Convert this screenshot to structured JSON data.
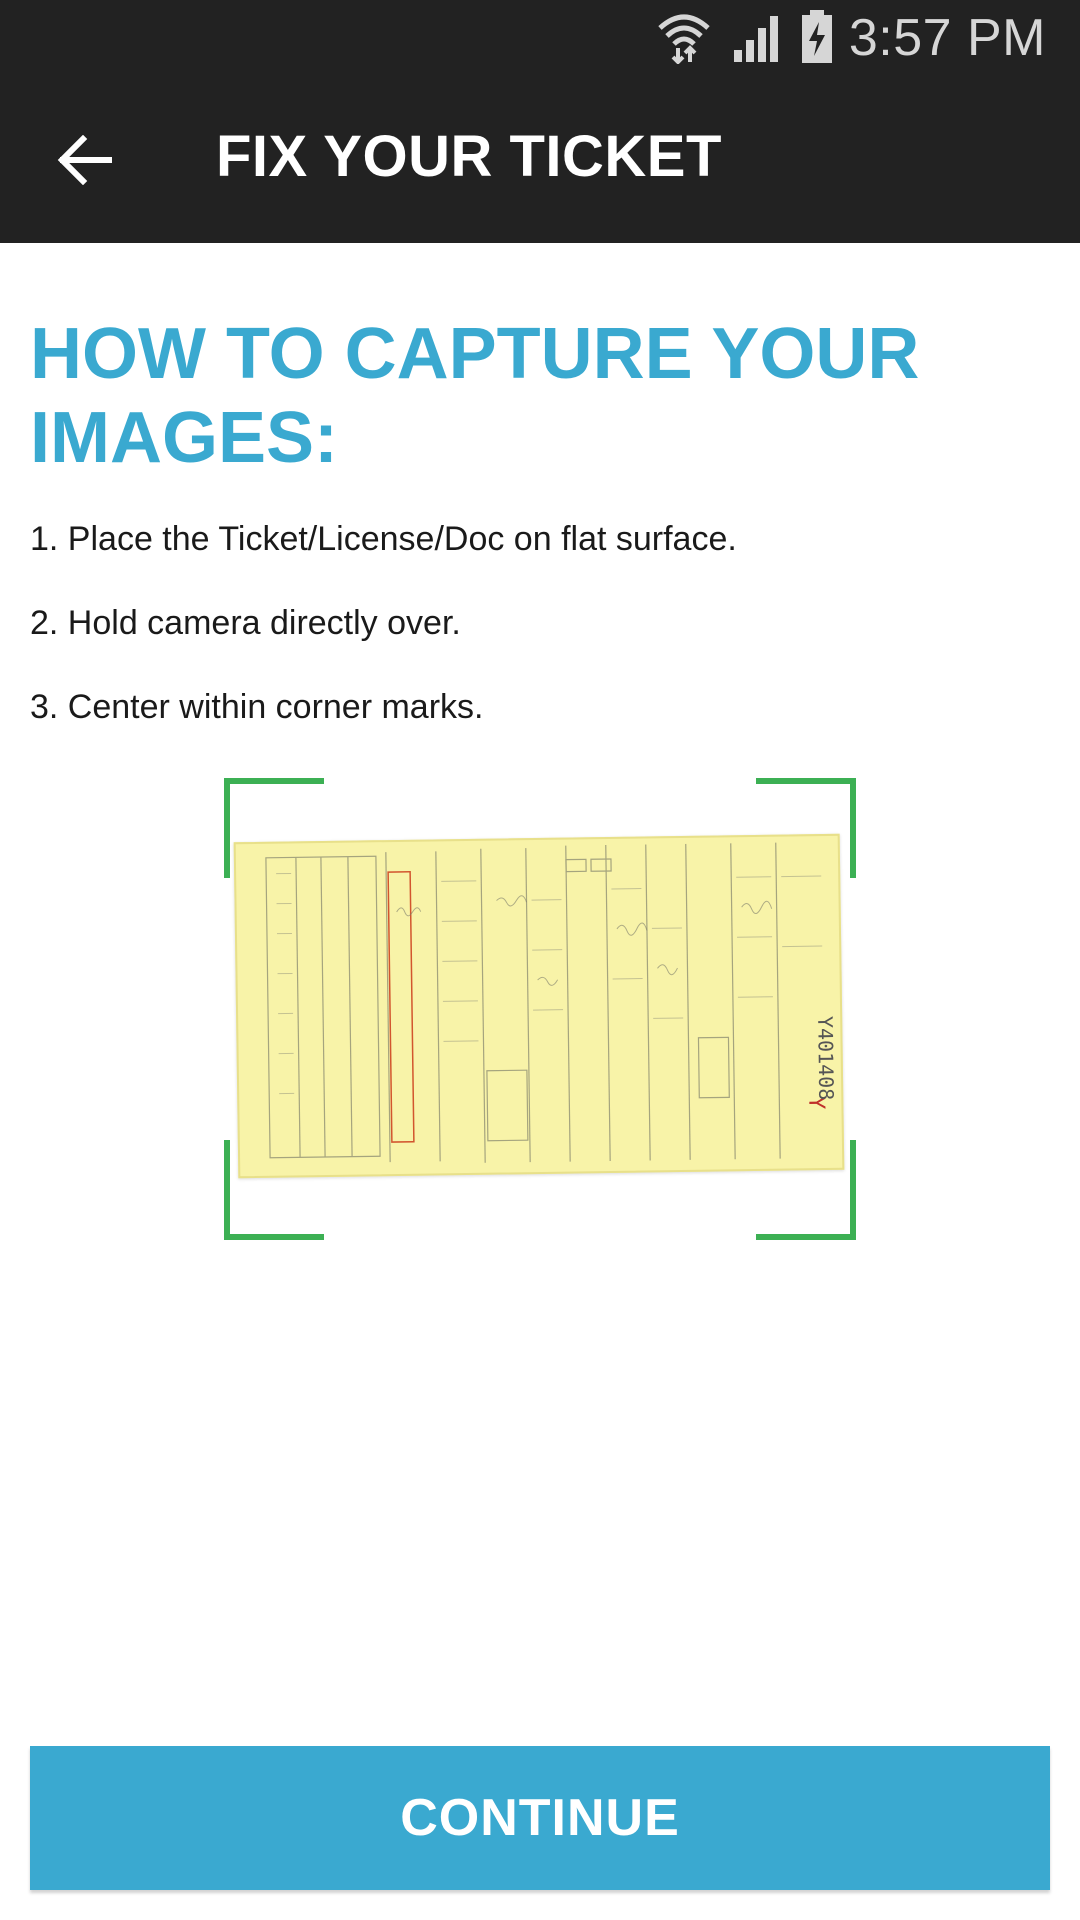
{
  "status_bar": {
    "time": "3:57 PM",
    "icons": [
      "wifi-icon",
      "signal-icon",
      "battery-charging-icon"
    ]
  },
  "app_bar": {
    "title": "FIX YOUR TICKET",
    "back_icon": "arrow-left-icon"
  },
  "instructions": {
    "heading": "HOW TO CAPTURE YOUR IMAGES:",
    "steps": [
      "1. Place the Ticket/License/Doc on flat surface.",
      "2. Hold camera directly over.",
      "3. Center within corner marks."
    ]
  },
  "example_image": {
    "description_icon": "ticket-sample-image",
    "corner_color": "#3cb054",
    "ticket_number": "Y401408"
  },
  "actions": {
    "continue_label": "CONTINUE"
  },
  "colors": {
    "accent": "#3aa9d0",
    "app_bar": "#222222"
  }
}
